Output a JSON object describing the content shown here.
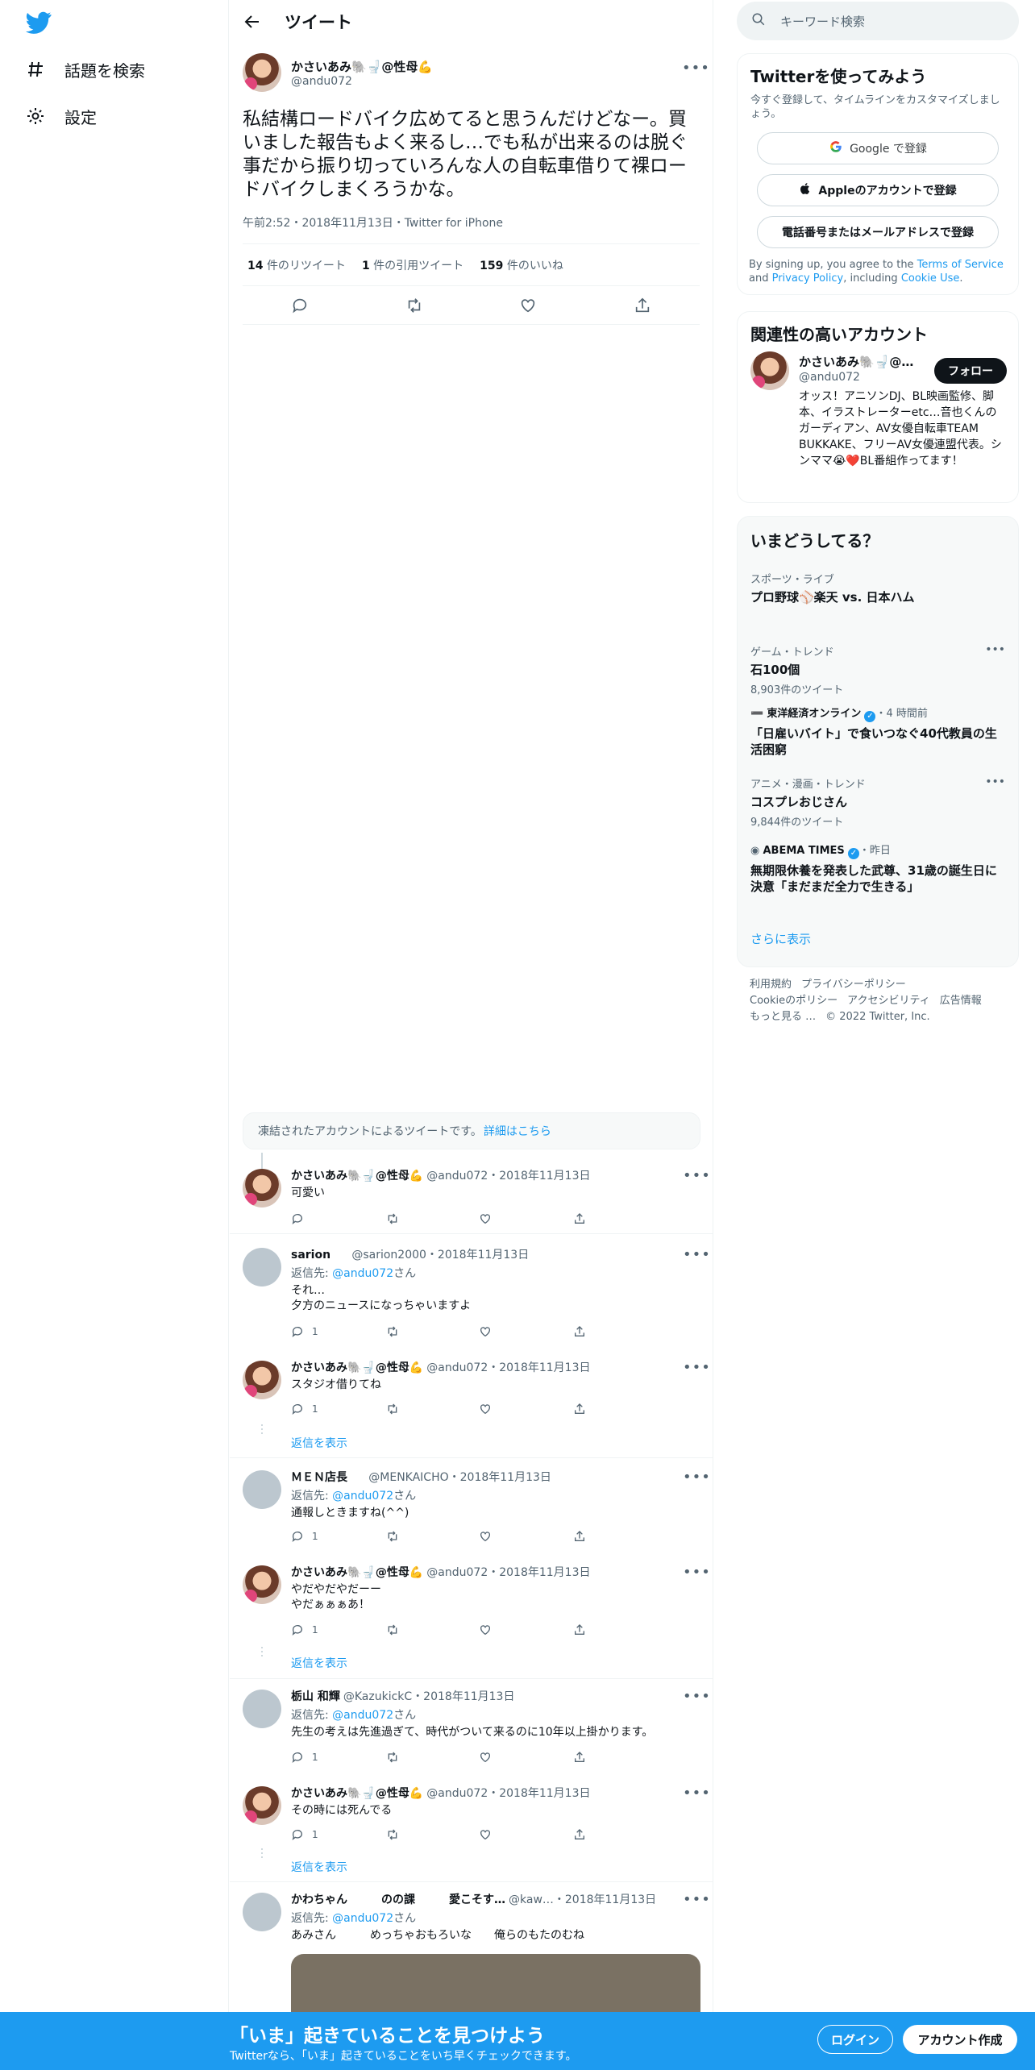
{
  "nav": {
    "explore": "話題を検索",
    "settings": "設定"
  },
  "header": {
    "title": "ツイート"
  },
  "main_tweet": {
    "display_name": "かさいあみ🐘🚽@性母💪",
    "handle": "@andu072",
    "text": "私結構ロードバイク広めてると思うんだけどなー。買いました報告もよく来るし…でも私が出来るのは脱ぐ事だから振り切っていろんな人の自転車借りて裸ロードバイクしまくろうかな。",
    "meta": "午前2:52・2018年11月13日・Twitter for iPhone",
    "retweets": "14",
    "retweets_label": "件のリツイート",
    "quotes": "1",
    "quotes_label": "件の引用ツイート",
    "likes": "159",
    "likes_label": "件のいいね"
  },
  "suspended": {
    "text": "凍結されたアカウントによるツイートです。",
    "link": "詳細はこちら"
  },
  "replies": [
    {
      "name": "かさいあみ🐘🚽@性母💪",
      "handle": "@andu072",
      "date": "・2018年11月13日",
      "reply_to": "",
      "text": "可愛い",
      "count": ""
    },
    {
      "name": "sarion",
      "handle": "@sarion2000",
      "date": "・2018年11月13日",
      "reply_to_prefix": "返信先: ",
      "reply_to": "@andu072",
      "reply_to_suffix": "さん",
      "text": "それ…",
      "text2": "夕方のニュースになっちゃいますよ",
      "count": "1"
    },
    {
      "name": "かさいあみ🐘🚽@性母💪",
      "handle": "@andu072",
      "date": "・2018年11月13日",
      "text": "スタジオ借りてね",
      "count": "1"
    },
    {
      "name": "ＭＥＮ店長",
      "handle": "@MENKAICHO",
      "date": "・2018年11月13日",
      "reply_to_prefix": "返信先: ",
      "reply_to": "@andu072",
      "reply_to_suffix": "さん",
      "text": "通報しときますね(^^)",
      "count": "1"
    },
    {
      "name": "かさいあみ🐘🚽@性母💪",
      "handle": "@andu072",
      "date": "・2018年11月13日",
      "text": "やだやだやだーー",
      "text2": "やだぁぁぁあ！",
      "count": "1"
    },
    {
      "name": "栃山 和輝",
      "handle": "@KazukickC",
      "date": "・2018年11月13日",
      "reply_to_prefix": "返信先: ",
      "reply_to": "@andu072",
      "reply_to_suffix": "さん",
      "text": "先生の考えは先進過ぎて、時代がついて来るのに10年以上掛かります。",
      "count": "1"
    },
    {
      "name": "かさいあみ🐘🚽@性母💪",
      "handle": "@andu072",
      "date": "・2018年11月13日",
      "text": "その時には死んでる",
      "count": "1"
    },
    {
      "name": "かわちゃん　　　のの課　　　愛こそす…",
      "handle": "@kaw…",
      "date": "・2018年11月13日",
      "reply_to_prefix": "返信先: ",
      "reply_to": "@andu072",
      "reply_to_suffix": "さん",
      "text": "あみさん　　　めっちゃおもろいな　　俺らのもたのむね",
      "count": ""
    }
  ],
  "show_replies": "返信を表示",
  "sidebar": {
    "search_placeholder": "キーワード検索",
    "signup_card": {
      "title": "Twitterを使ってみよう",
      "subtitle": "今すぐ登録して、タイムラインをカスタマイズしましょう。",
      "google": "Google で登録",
      "apple": "Appleのアカウントで登録",
      "phone": "電話番号またはメールアドレスで登録",
      "terms_prefix": "By signing up, you agree to the ",
      "terms_link": "Terms of Service",
      "terms_and": " and ",
      "privacy_link": "Privacy Policy",
      "terms_including": ", including ",
      "cookie_link": "Cookie Use",
      "terms_end": "."
    },
    "related": {
      "title": "関連性の高いアカウント",
      "name": "かさいあみ🐘🚽@…",
      "handle": "@andu072",
      "follow": "フォロー",
      "bio": "オッス！アニソンDJ、BL映画監修、脚本、イラストレーターetc…音也くんのガーディアン、AV女優自転車TEAM BUKKAKE、フリーAV女優連盟代表。シンママ😭❤️BL番組作ってます！"
    },
    "trends": {
      "title": "いまどうしてる？",
      "items": [
        {
          "category": "スポーツ・ライブ",
          "title": "プロ野球⚾楽天 vs. 日本ハム",
          "count": ""
        },
        {
          "category": "ゲーム・トレンド",
          "title": "石100個",
          "count": "8,903件のツイート"
        },
        {
          "category": "東洋経済オンライン",
          "time": "・4 時間前",
          "title": "「日雇いバイト」で食いつなぐ40代教員の生活困窮",
          "count": ""
        },
        {
          "category": "アニメ・漫画・トレンド",
          "title": "コスプレおじさん",
          "count": "9,844件のツイート"
        },
        {
          "category": "ABEMA TIMES",
          "time": "・昨日",
          "title": "無期限休養を発表した武尊、31歳の誕生日に決意「まだまだ全力で生きる」",
          "count": ""
        }
      ],
      "show_more": "さらに表示"
    },
    "footer": {
      "l1a": "利用規約",
      "l1b": "プライバシーポリシー",
      "l2a": "Cookieのポリシー",
      "l2b": "アクセシビリティ",
      "l2c": "広告情報",
      "l3a": "もっと見る …",
      "l3b": "© 2022 Twitter, Inc."
    }
  },
  "banner": {
    "headline": "「いま」起きていることを見つけよう",
    "sub": "Twitterなら、「いま」起きていることをいち早くチェックできます。",
    "login": "ログイン",
    "signup": "アカウント作成"
  },
  "colors": {
    "accent": "#1d9bf0",
    "text": "#0f1419",
    "muted": "#536471"
  }
}
